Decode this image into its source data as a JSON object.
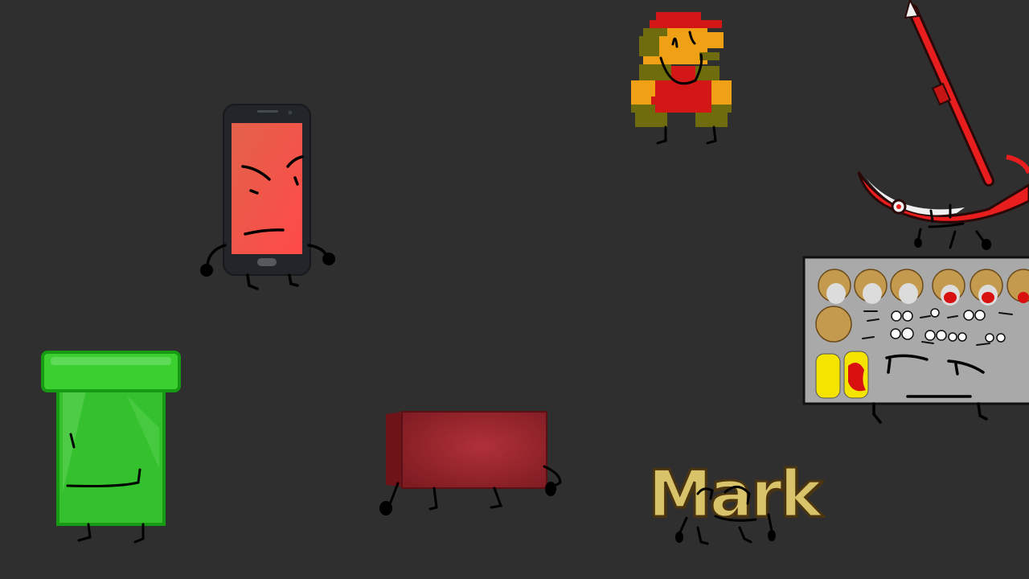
{
  "scene": {
    "background_color": "#2f2f2f",
    "characters": [
      {
        "id": "phone",
        "icon": "phone-icon",
        "colors": {
          "body": "#22262b",
          "screen_top": "#e2614a",
          "screen_bottom": "#ff4a48"
        }
      },
      {
        "id": "pixel-hero",
        "icon": "pixel-sprite-icon",
        "colors": {
          "red": "#d31616",
          "olive": "#6e6c0c",
          "orange": "#f0a015"
        }
      },
      {
        "id": "scythe",
        "icon": "scythe-icon",
        "colors": {
          "red": "#e81d1d",
          "dark": "#2b0808",
          "white": "#f0f0f0"
        }
      },
      {
        "id": "pipe",
        "icon": "pipe-icon",
        "colors": {
          "green": "#35c12d",
          "dark_green": "#179a14",
          "highlight": "#7ee27a"
        }
      },
      {
        "id": "asset-sheet",
        "icon": "asset-sheet-icon",
        "colors": {
          "panel": "#a9a9a9",
          "border": "#111111",
          "hair": "#c49a4e",
          "yellow": "#f4e400"
        }
      },
      {
        "id": "red-block",
        "icon": "block-icon",
        "colors": {
          "face": "#9d2a2f",
          "edge": "#6e1418"
        }
      },
      {
        "id": "mark",
        "icon": "text-character-icon",
        "colors": {
          "fill": "#d9c36a",
          "outline": "#4a3510"
        }
      }
    ]
  },
  "mark_character": {
    "label": "Mark"
  }
}
